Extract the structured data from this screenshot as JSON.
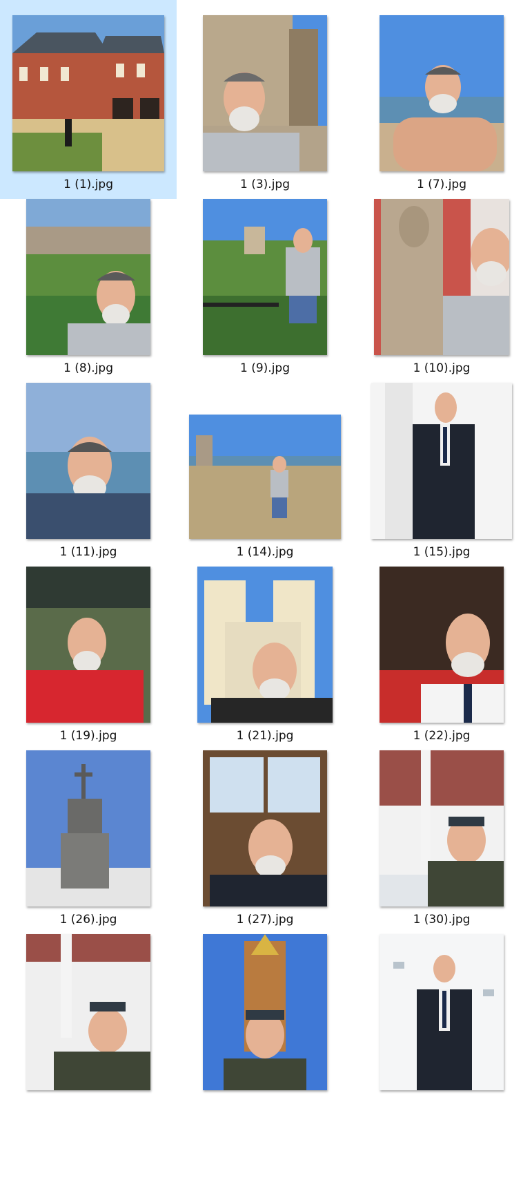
{
  "explorer": {
    "items": [
      {
        "filename": "1 (1).jpg",
        "selected": true,
        "scene": "building"
      },
      {
        "filename": "1 (3).jpg",
        "selected": false,
        "scene": "fortress-selfie"
      },
      {
        "filename": "1 (7).jpg",
        "selected": false,
        "scene": "beach"
      },
      {
        "filename": "1 (8).jpg",
        "selected": false,
        "scene": "fortress-selfie"
      },
      {
        "filename": "1 (9).jpg",
        "selected": false,
        "scene": "garden-standing"
      },
      {
        "filename": "1 (10).jpg",
        "selected": false,
        "scene": "statue-selfie"
      },
      {
        "filename": "1 (11).jpg",
        "selected": false,
        "scene": "sea-selfie"
      },
      {
        "filename": "1 (14).jpg",
        "selected": false,
        "scene": "hill-standing"
      },
      {
        "filename": "1 (15).jpg",
        "selected": false,
        "scene": "studio-suit"
      },
      {
        "filename": "1 (19).jpg",
        "selected": false,
        "scene": "red-sweater"
      },
      {
        "filename": "1 (21).jpg",
        "selected": false,
        "scene": "church-selfie"
      },
      {
        "filename": "1 (22).jpg",
        "selected": false,
        "scene": "red-carpet"
      },
      {
        "filename": "1 (26).jpg",
        "selected": false,
        "scene": "monument"
      },
      {
        "filename": "1 (27).jpg",
        "selected": false,
        "scene": "window-selfie"
      },
      {
        "filename": "1 (30).jpg",
        "selected": false,
        "scene": "winter-selfie"
      },
      {
        "filename": "",
        "selected": false,
        "scene": "winter-selfie-2"
      },
      {
        "filename": "",
        "selected": false,
        "scene": "chapel-selfie"
      },
      {
        "filename": "",
        "selected": false,
        "scene": "pressboard-suit"
      }
    ]
  },
  "colors": {
    "selection_bg": "#cce8ff",
    "sky": "#4f8fe0",
    "sea": "#5d8fb3",
    "brick": "#b5563d",
    "stone": "#a99a86",
    "skin": "#e5b294",
    "beard": "#e8e6e2",
    "shirt_gray": "#b9bec4",
    "suit": "#1f2530",
    "sweater_red": "#d7262f",
    "grass": "#5c8e3e"
  }
}
